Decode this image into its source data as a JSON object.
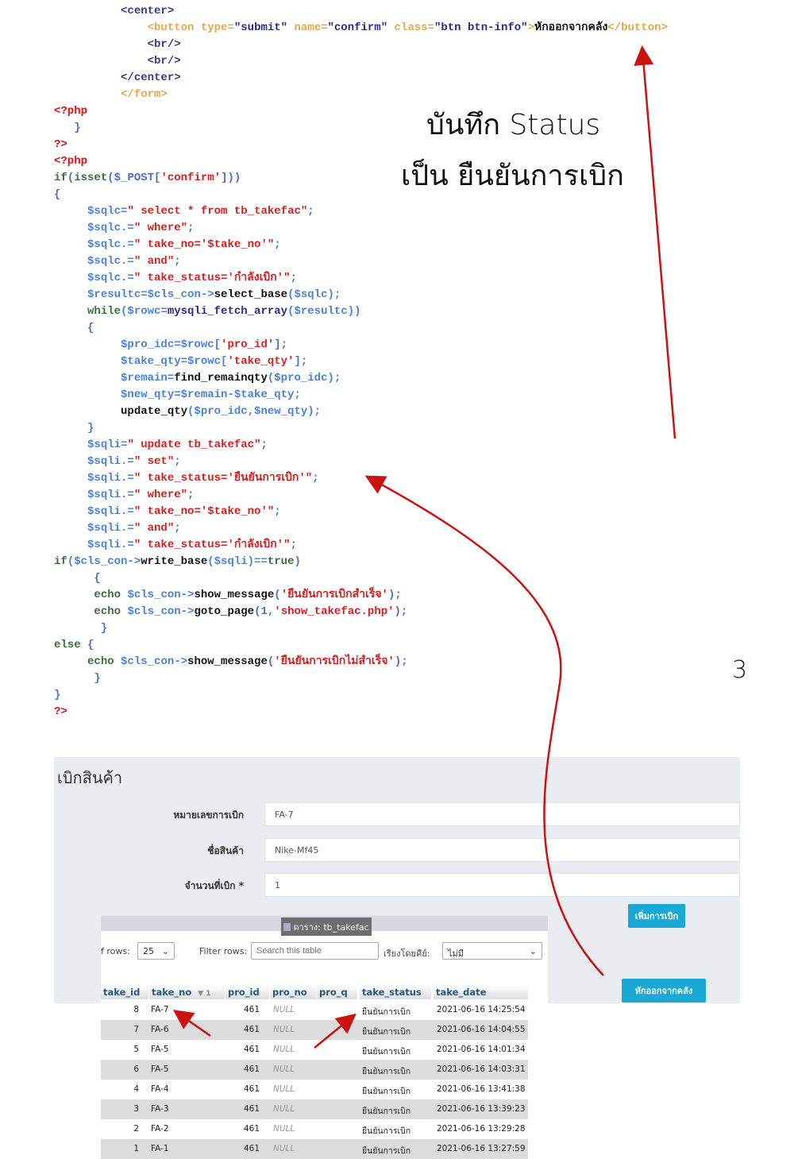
{
  "code_lines": [
    [
      [
        "          ",
        "t-txt"
      ],
      [
        "<center>",
        "t-tag"
      ]
    ],
    [
      [
        "              ",
        "t-txt"
      ],
      [
        "<button ",
        "t-otag"
      ],
      [
        "type=",
        "t-attr"
      ],
      [
        "\"submit\" ",
        "t-val"
      ],
      [
        "name=",
        "t-attr"
      ],
      [
        "\"confirm\" ",
        "t-val"
      ],
      [
        "class=",
        "t-attr"
      ],
      [
        "\"btn btn-info\"",
        "t-val"
      ],
      [
        ">",
        "t-otag"
      ],
      [
        "หักออกจากคลัง",
        "t-txt"
      ],
      [
        "</button>",
        "t-otag"
      ]
    ],
    [
      [
        "              ",
        "t-txt"
      ],
      [
        "<br/>",
        "t-tag"
      ]
    ],
    [
      [
        "              ",
        "t-txt"
      ],
      [
        "<br/>",
        "t-tag"
      ]
    ],
    [
      [
        "          ",
        "t-txt"
      ],
      [
        "</center>",
        "t-tag"
      ]
    ],
    [
      [
        "          ",
        "t-txt"
      ],
      [
        "</form>",
        "t-otag"
      ]
    ],
    [
      [
        "<?php",
        "t-php"
      ]
    ],
    [
      [
        "   }",
        "t-p"
      ]
    ],
    [
      [
        "?>",
        "t-php"
      ]
    ],
    [
      [
        "<?php",
        "t-php"
      ]
    ],
    [
      [
        "if",
        "t-kw"
      ],
      [
        "(",
        "t-p"
      ],
      [
        "isset",
        "t-kw"
      ],
      [
        "($_POST[",
        "t-p"
      ],
      [
        "'confirm'",
        "t-str"
      ],
      [
        "]))",
        "t-p"
      ]
    ],
    [
      [
        "{",
        "t-p"
      ]
    ],
    [
      [
        "     ",
        "t-txt"
      ],
      [
        "$sqlc=",
        "t-var"
      ],
      [
        "\" select * from tb_takefac\"",
        "t-str"
      ],
      [
        ";",
        "t-p"
      ]
    ],
    [
      [
        "     ",
        "t-txt"
      ],
      [
        "$sqlc.=",
        "t-var"
      ],
      [
        "\" where\"",
        "t-str"
      ],
      [
        ";",
        "t-p"
      ]
    ],
    [
      [
        "     ",
        "t-txt"
      ],
      [
        "$sqlc.=",
        "t-var"
      ],
      [
        "\" take_no='$take_no'\"",
        "t-str"
      ],
      [
        ";",
        "t-p"
      ]
    ],
    [
      [
        "     ",
        "t-txt"
      ],
      [
        "$sqlc.=",
        "t-var"
      ],
      [
        "\" and\"",
        "t-str"
      ],
      [
        ";",
        "t-p"
      ]
    ],
    [
      [
        "     ",
        "t-txt"
      ],
      [
        "$sqlc.=",
        "t-var"
      ],
      [
        "\" take_status='กำลังเบิก'\"",
        "t-str"
      ],
      [
        ";",
        "t-p"
      ]
    ],
    [
      [
        "     ",
        "t-txt"
      ],
      [
        "$resultc=$cls_con->",
        "t-var"
      ],
      [
        "select_base",
        "t-fn"
      ],
      [
        "($sqlc);",
        "t-var"
      ]
    ],
    [
      [
        "     ",
        "t-txt"
      ],
      [
        "while",
        "t-kw"
      ],
      [
        "($rowc=",
        "t-var"
      ],
      [
        "mysqli_fetch_array",
        "t-val"
      ],
      [
        "($resultc))",
        "t-var"
      ]
    ],
    [
      [
        "     {",
        "t-p"
      ]
    ],
    [
      [
        "          ",
        "t-txt"
      ],
      [
        "$pro_idc=$rowc[",
        "t-var"
      ],
      [
        "'pro_id'",
        "t-str"
      ],
      [
        "];",
        "t-p"
      ]
    ],
    [
      [
        "          ",
        "t-txt"
      ],
      [
        "$take_qty=$rowc[",
        "t-var"
      ],
      [
        "'take_qty'",
        "t-str"
      ],
      [
        "];",
        "t-p"
      ]
    ],
    [
      [
        "          ",
        "t-txt"
      ],
      [
        "$remain=",
        "t-var"
      ],
      [
        "find_remainqty",
        "t-fn"
      ],
      [
        "($pro_idc);",
        "t-var"
      ]
    ],
    [
      [
        "          ",
        "t-txt"
      ],
      [
        "$new_qty=$remain-$take_qty;",
        "t-var"
      ]
    ],
    [
      [
        "          ",
        "t-txt"
      ],
      [
        "update_qty",
        "t-fn"
      ],
      [
        "($pro_idc,$new_qty);",
        "t-var"
      ]
    ],
    [
      [
        "     }",
        "t-p"
      ]
    ],
    [
      [
        "     ",
        "t-txt"
      ],
      [
        "$sqli=",
        "t-var"
      ],
      [
        "\" update tb_takefac\"",
        "t-str"
      ],
      [
        ";",
        "t-p"
      ]
    ],
    [
      [
        "     ",
        "t-txt"
      ],
      [
        "$sqli.=",
        "t-var"
      ],
      [
        "\" set\"",
        "t-str"
      ],
      [
        ";",
        "t-p"
      ]
    ],
    [
      [
        "     ",
        "t-txt"
      ],
      [
        "$sqli.=",
        "t-var"
      ],
      [
        "\" take_status='ยืนยันการเบิก'\"",
        "t-str"
      ],
      [
        ";",
        "t-p"
      ]
    ],
    [
      [
        "     ",
        "t-txt"
      ],
      [
        "$sqli.=",
        "t-var"
      ],
      [
        "\" where\"",
        "t-str"
      ],
      [
        ";",
        "t-p"
      ]
    ],
    [
      [
        "     ",
        "t-txt"
      ],
      [
        "$sqli.=",
        "t-var"
      ],
      [
        "\" take_no='$take_no'\"",
        "t-str"
      ],
      [
        ";",
        "t-p"
      ]
    ],
    [
      [
        "     ",
        "t-txt"
      ],
      [
        "$sqli.=",
        "t-var"
      ],
      [
        "\" and\"",
        "t-str"
      ],
      [
        ";",
        "t-p"
      ]
    ],
    [
      [
        "     ",
        "t-txt"
      ],
      [
        "$sqli.=",
        "t-var"
      ],
      [
        "\" take_status='กำลังเบิก'\"",
        "t-str"
      ],
      [
        ";",
        "t-p"
      ]
    ],
    [
      [
        "if",
        "t-kw"
      ],
      [
        "($cls_con->",
        "t-var"
      ],
      [
        "write_base",
        "t-fn"
      ],
      [
        "($sqli)==",
        "t-var"
      ],
      [
        "true",
        "t-kw"
      ],
      [
        ")",
        "t-p"
      ]
    ],
    [
      [
        "      {",
        "t-p"
      ]
    ],
    [
      [
        "      ",
        "t-txt"
      ],
      [
        "echo ",
        "t-kw"
      ],
      [
        "$cls_con->",
        "t-var"
      ],
      [
        "show_message",
        "t-fn"
      ],
      [
        "(",
        "t-p"
      ],
      [
        "'ยืนยันการเบิกสำเร็จ'",
        "t-str"
      ],
      [
        ");",
        "t-p"
      ]
    ],
    [
      [
        "      ",
        "t-txt"
      ],
      [
        "echo ",
        "t-kw"
      ],
      [
        "$cls_con->",
        "t-var"
      ],
      [
        "goto_page",
        "t-fn"
      ],
      [
        "(1,",
        "t-p"
      ],
      [
        "'show_takefac.php'",
        "t-str"
      ],
      [
        ");",
        "t-p"
      ]
    ],
    [
      [
        "       }",
        "t-p"
      ]
    ],
    [
      [
        "else ",
        "t-kw"
      ],
      [
        "{",
        "t-p"
      ]
    ],
    [
      [
        "     ",
        "t-txt"
      ],
      [
        "echo ",
        "t-kw"
      ],
      [
        "$cls_con->",
        "t-var"
      ],
      [
        "show_message",
        "t-fn"
      ],
      [
        "(",
        "t-p"
      ],
      [
        "'ยืนยันการเบิกไม่สำเร็จ'",
        "t-str"
      ],
      [
        ");",
        "t-p"
      ]
    ],
    [
      [
        "      }",
        "t-p"
      ]
    ],
    [
      [
        "}",
        "t-p"
      ]
    ],
    [
      [
        "?>",
        "t-php"
      ]
    ]
  ],
  "annotations": {
    "line1": "บันทึก Status",
    "line2": "เป็น ยืนยันการเบิก",
    "step_number": "3",
    "arrow_color": "#cc1111"
  },
  "form": {
    "title": "เบิกสินค้า",
    "fields": [
      {
        "label": "หมายเลขการเบิก",
        "value": "FA-7"
      },
      {
        "label": "ชื่อสินค้า",
        "value": "Nike-Mf45"
      },
      {
        "label": "จำนวนที่เบิก *",
        "value": "1"
      }
    ],
    "add_button": "เพิ่มการเบิก",
    "deduct_button": "หักออกจากคลัง",
    "button_color": "#19a9d4"
  },
  "table_panel": {
    "tooltip": "ตาราง: tb_takefac",
    "rows_label": "f rows:",
    "rows_value": "25",
    "filter_label": "Filter rows:",
    "filter_placeholder": "Search this table",
    "sort_label": "เรียงโดยคีย์:",
    "sort_value": "ไม่มี",
    "columns": [
      "take_id",
      "take_no",
      "pro_id",
      "pro_no",
      "pro_q",
      "take_status",
      "take_date"
    ],
    "sort_indicator": "▼ 1",
    "rows": [
      [
        "8",
        "FA-7",
        "461",
        "NULL",
        "",
        "ยืนยันการเบิก",
        "2021-06-16 14:25:54"
      ],
      [
        "7",
        "FA-6",
        "461",
        "NULL",
        "",
        "ยืนยันการเบิก",
        "2021-06-16 14:04:55"
      ],
      [
        "5",
        "FA-5",
        "461",
        "NULL",
        "",
        "ยืนยันการเบิก",
        "2021-06-16 14:01:34"
      ],
      [
        "6",
        "FA-5",
        "461",
        "NULL",
        "",
        "ยืนยันการเบิก",
        "2021-06-16 14:03:31"
      ],
      [
        "4",
        "FA-4",
        "461",
        "NULL",
        "",
        "ยืนยันการเบิก",
        "2021-06-16 13:41:38"
      ],
      [
        "3",
        "FA-3",
        "461",
        "NULL",
        "",
        "ยืนยันการเบิก",
        "2021-06-16 13:39:23"
      ],
      [
        "2",
        "FA-2",
        "461",
        "NULL",
        "",
        "ยืนยันการเบิก",
        "2021-06-16 13:29:28"
      ],
      [
        "1",
        "FA-1",
        "461",
        "NULL",
        "",
        "ยืนยันการเบิก",
        "2021-06-16 13:27:59"
      ]
    ]
  }
}
